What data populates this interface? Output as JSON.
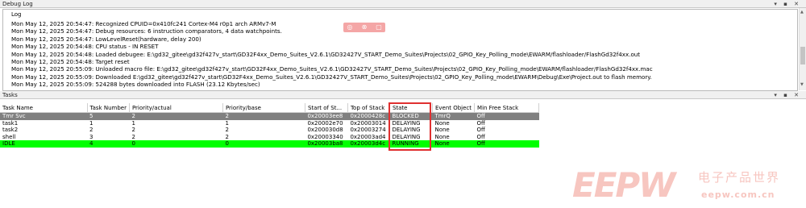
{
  "debug_log": {
    "title": "Debug Log",
    "header": "Log",
    "lines": [
      "Mon May 12, 2025 20:54:47: Recognized CPUID=0x410fc241 Cortex-M4 r0p1 arch ARMv7-M",
      "Mon May 12, 2025 20:54:47: Debug resources: 6 instruction comparators, 4 data watchpoints.",
      "Mon May 12, 2025 20:54:47: LowLevelReset(hardware, delay 200)",
      "Mon May 12, 2025 20:54:48: CPU status - IN RESET",
      "Mon May 12, 2025 20:54:48: Loaded debugee: E:\\gd32_gitee\\gd32f427v_start\\GD32F4xx_Demo_Suites_V2.6.1\\GD32427V_START_Demo_Suites\\Projects\\02_GPIO_Key_Polling_mode\\EWARM/flashloader/FlashGd32f4xx.out",
      "Mon May 12, 2025 20:54:48: Target reset",
      "Mon May 12, 2025 20:55:09: Unloaded macro file: E:\\gd32_gitee\\gd32f427v_start\\GD32F4xx_Demo_Suites_V2.6.1\\GD32427V_START_Demo_Suites\\Projects\\02_GPIO_Key_Polling_mode\\EWARM/flashloader/FlashGd32f4xx.mac",
      "Mon May 12, 2025 20:55:09: Downloaded E:\\gd32_gitee\\gd32f427v_start\\GD32F4xx_Demo_Suites_V2.6.1\\GD32427V_START_Demo_Suites\\Projects\\02_GPIO_Key_Polling_mode\\EWARM\\Debug\\Exe\\Project.out to flash memory.",
      "Mon May 12, 2025 20:55:09: 524288 bytes downloaded into FLASH (23.12 Kbytes/sec)"
    ]
  },
  "panel_buttons": "▾ ▪ ✕",
  "tasks": {
    "title": "Tasks",
    "columns": [
      "Task Name",
      "Task Number",
      "Priority/actual",
      "Priority/base",
      "Start of St...",
      "Top of Stack",
      "State",
      "Event Object",
      "Min Free Stack"
    ],
    "rows": [
      [
        "Tmr Svc",
        "5",
        "2",
        "2",
        "0x20003ee8",
        "0x2000428c",
        "BLOCKED",
        "TmrQ",
        "Off"
      ],
      [
        "task1",
        "1",
        "1",
        "1",
        "0x20002e70",
        "0x20003014",
        "DELAYING",
        "None",
        "Off"
      ],
      [
        "task2",
        "2",
        "2",
        "2",
        "0x200030d8",
        "0x20003274",
        "DELAYING",
        "None",
        "Off"
      ],
      [
        "shell",
        "3",
        "2",
        "2",
        "0x20003340",
        "0x20003ad4",
        "DELAYING",
        "None",
        "Off"
      ],
      [
        "IDLE",
        "4",
        "0",
        "0",
        "0x20003ba8",
        "0x20003d4c",
        "RUNNING",
        "None",
        "Off"
      ]
    ],
    "row_styles": [
      "gray",
      "normal",
      "normal",
      "normal",
      "green"
    ]
  },
  "colors": {
    "highlight_gray": "#808080",
    "highlight_green": "#00ff00",
    "annotation_red": "#e03030",
    "watermark": "#f7c6c0"
  },
  "watermark": {
    "brand": "EEPW",
    "cn": "电子产品世界",
    "url": "eepw.com.cn"
  }
}
